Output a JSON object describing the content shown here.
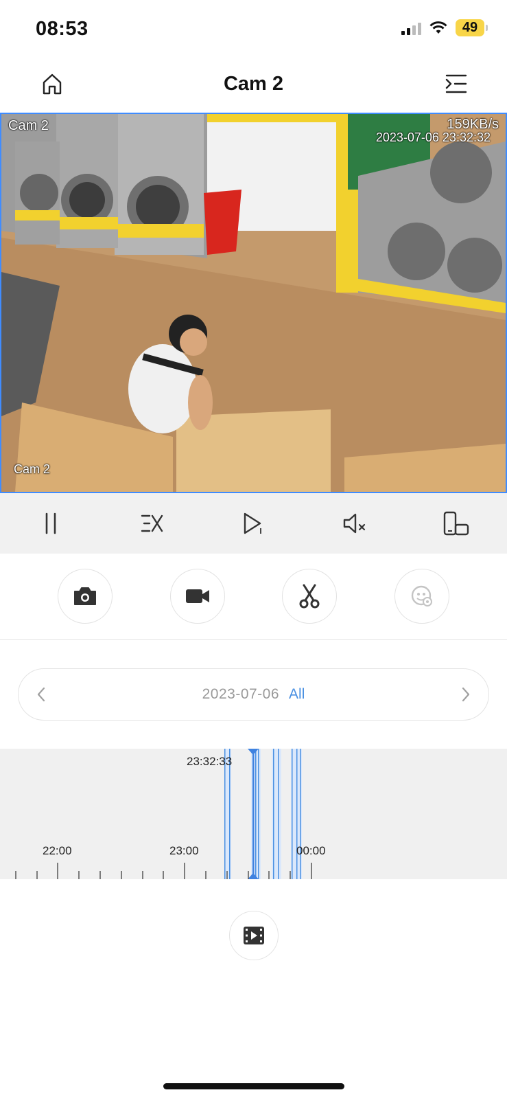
{
  "status_bar": {
    "time": "08:53",
    "battery": "49"
  },
  "nav": {
    "title": "Cam 2"
  },
  "video": {
    "osd_name_top": "Cam 2",
    "bitrate": "159KB/s",
    "timestamp": "2023-07-06 23:32:32",
    "osd_name_bottom": "Cam 2"
  },
  "date_selector": {
    "date": "2023-07-06",
    "filter": "All"
  },
  "timeline": {
    "cursor_time": "23:32:33",
    "labels": [
      "22:00",
      "23:00",
      "00:00"
    ]
  },
  "colors": {
    "accent": "#4a90e2",
    "battery": "#f8d548",
    "video_border": "#3f8cff"
  },
  "icons": {
    "nav_left": "home-icon",
    "nav_right": "menu-icon",
    "controls": [
      "pause-icon",
      "speed-icon",
      "play-frame-icon",
      "mute-icon",
      "orientation-icon"
    ],
    "actions": [
      "camera-icon",
      "video-record-icon",
      "scissors-icon",
      "face-detect-icon"
    ],
    "bottom": "film-icon"
  }
}
